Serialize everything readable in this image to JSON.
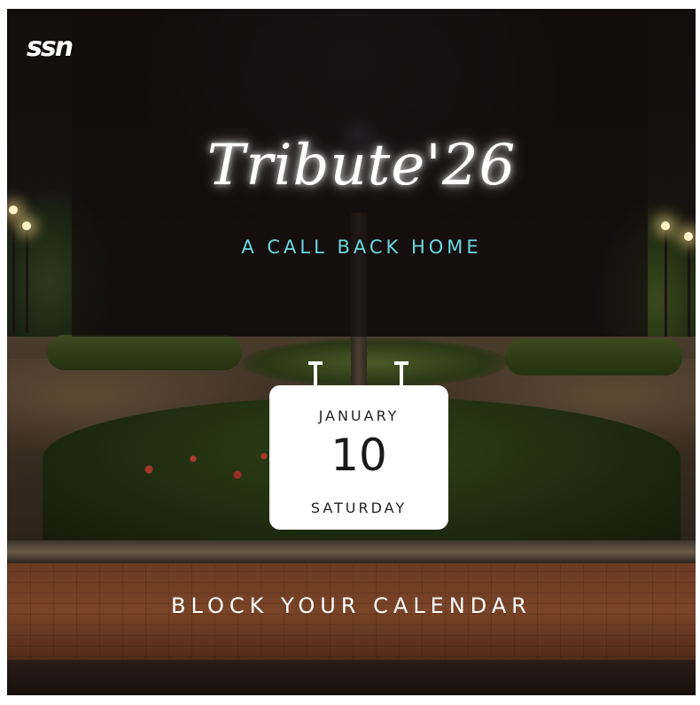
{
  "logo": {
    "text": "ssn"
  },
  "event": {
    "title": "Tribute'26",
    "subtitle": "A CALL BACK HOME"
  },
  "calendar": {
    "month": "JANUARY",
    "day": "10",
    "weekday": "SATURDAY"
  },
  "footer": {
    "cta": "BLOCK YOUR CALENDAR"
  },
  "colors": {
    "subtitle_accent": "#6ad8df",
    "overlay": "#120c0c",
    "calendar_bg": "#ffffff"
  }
}
